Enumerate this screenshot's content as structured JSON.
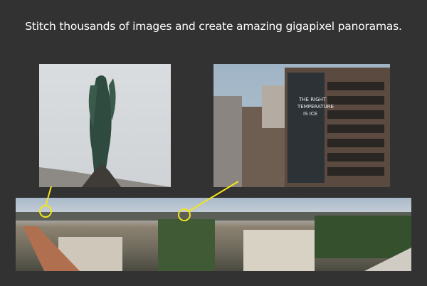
{
  "headline": "Stitch thousands of images and create amazing gigapixel panoramas.",
  "colors": {
    "background": "#323232",
    "highlight": "#f2e51c"
  },
  "images": {
    "detail_left": "angel-statue-closeup",
    "detail_right": "building-billboard-closeup",
    "panorama": "city-skyline-panorama"
  }
}
